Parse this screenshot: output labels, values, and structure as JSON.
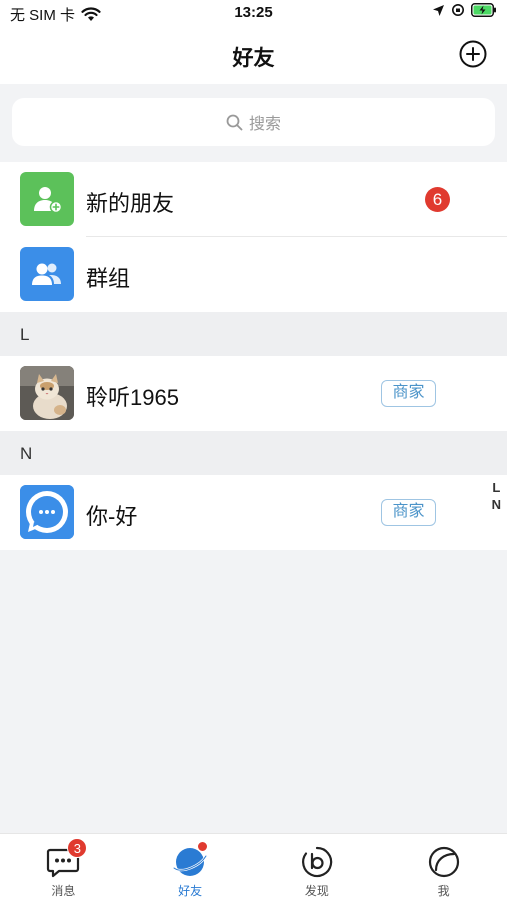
{
  "status_bar": {
    "carrier": "无 SIM 卡",
    "time": "13:25"
  },
  "nav": {
    "title": "好友"
  },
  "search": {
    "placeholder": "搜索"
  },
  "entries": [
    {
      "label": "新的朋友",
      "badge": "6"
    },
    {
      "label": "群组"
    }
  ],
  "sections": [
    {
      "letter": "L",
      "contacts": [
        {
          "name": "聆听1965",
          "tag": "商家"
        }
      ]
    },
    {
      "letter": "N",
      "contacts": [
        {
          "name": "你-好",
          "tag": "商家"
        }
      ]
    }
  ],
  "index_letters": [
    "L",
    "N"
  ],
  "tabbar": {
    "tabs": [
      {
        "label": "消息",
        "badge": "3"
      },
      {
        "label": "好友",
        "active": true
      },
      {
        "label": "发现"
      },
      {
        "label": "我"
      }
    ]
  },
  "colors": {
    "accent": "#2a7bd3",
    "badge": "#e03a2f",
    "green_icon": "#5cc15a",
    "blue_icon": "#3b8ee8",
    "tag_text": "#4c94c9"
  }
}
